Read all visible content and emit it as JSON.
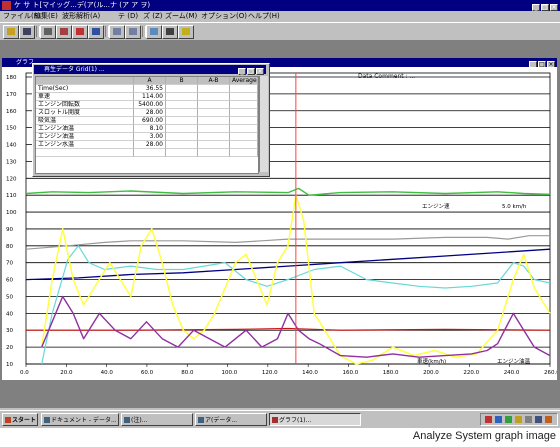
{
  "window": {
    "title": "ケ サ ト[マイッグ...デ(ア(ル...ナ (ア ア ヲ)"
  },
  "menu": [
    "ファイル(F)",
    "編集(E)",
    "波形解析(A)",
    "テ (D)",
    "ズ (Z)",
    "ズーム(M)",
    "オプション(O)",
    "ヘルプ(H)"
  ],
  "child_window": {
    "title": "グラフ"
  },
  "data_comment": "Data Comment : ...",
  "grid": {
    "title": "再生データ Grid(1) ...",
    "headers": [
      "",
      "A",
      "B",
      "A-B",
      "Average"
    ],
    "rows": [
      {
        "label": "Time(Sec)",
        "a": "36.55"
      },
      {
        "label": "車速",
        "a": "114.00"
      },
      {
        "label": "エンジン回転数",
        "a": "5400.00"
      },
      {
        "label": "スロットル開度",
        "a": "28.00"
      },
      {
        "label": "吸気温",
        "a": "690.00"
      },
      {
        "label": "エンジン油温",
        "a": "8.10"
      },
      {
        "label": "エンジン油温",
        "a": "3.00"
      },
      {
        "label": "エンジン水温",
        "a": "28.00"
      }
    ]
  },
  "y_ticks": [
    "180",
    "170",
    "160",
    "150",
    "140",
    "130",
    "120",
    "110",
    "100",
    "90",
    "80",
    "70",
    "60",
    "50",
    "40",
    "30",
    "20",
    "10"
  ],
  "x_ticks": [
    "0.0",
    "20.0",
    "40.0",
    "60.0",
    "80.0",
    "100.0",
    "120.0",
    "140.0",
    "160.0",
    "180.0",
    "200.0",
    "220.0",
    "240.0",
    "260.0"
  ],
  "annotations": {
    "engine_label": "エンジン速",
    "engine_right": "5.0 km/h",
    "bottom_label": "車速(km/h)",
    "bottom_right": "エンジン油温"
  },
  "taskbar": {
    "start": "スタート",
    "tasks": [
      "ドキュメント - データ...",
      "(注)...",
      "ア(データ...",
      "グラフ(1)..."
    ]
  },
  "caption": "Analyze System graph image",
  "colors": {
    "green": "#3fbf3f",
    "gray": "#9a9a9a",
    "navy": "#000080",
    "yellow": "#ffff40",
    "cyan": "#66d8d8",
    "purple": "#9030a0",
    "red": "#cc1010",
    "cursor": "#ff4040"
  }
}
